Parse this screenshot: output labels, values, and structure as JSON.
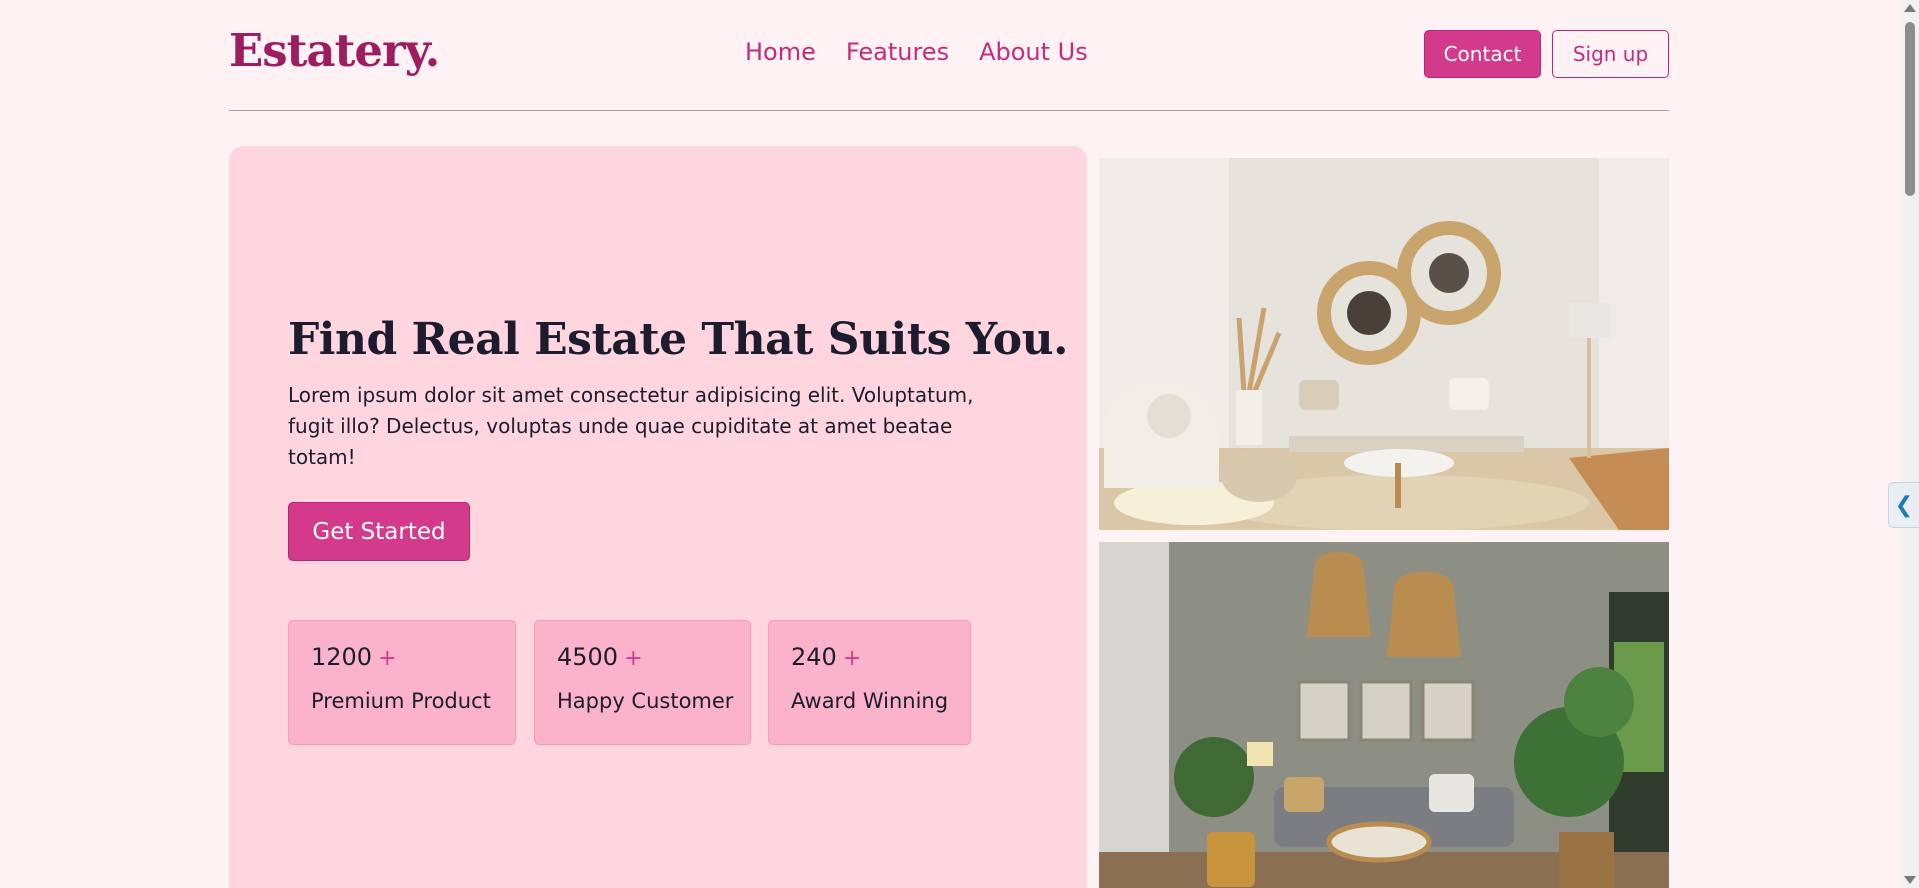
{
  "brand": {
    "logo": "Estatery."
  },
  "nav": {
    "items": [
      "Home",
      "Features",
      "About Us"
    ]
  },
  "header_buttons": {
    "contact": "Contact",
    "signup": "Sign up"
  },
  "hero": {
    "title": "Find Real Estate That Suits You.",
    "description": "Lorem ipsum dolor sit amet consectetur adipisicing elit. Voluptatum, fugit illo? Delectus, voluptas unde quae cupiditate at amet beatae totam!",
    "cta": "Get Started",
    "stats": [
      {
        "number": "1200",
        "plus": "+",
        "label": "Premium Product"
      },
      {
        "number": "4500",
        "plus": "+",
        "label": "Happy Customer"
      },
      {
        "number": "240",
        "plus": "+",
        "label": "Award Winning"
      }
    ]
  },
  "side_tab": {
    "icon": "chevron-left-icon",
    "glyph": "❮"
  },
  "colors": {
    "brand": "#9c1e60",
    "accent": "#d33a8c",
    "hero_bg": "#ffd6e0",
    "page_bg": "#fff2f4",
    "stat_bg": "#fbb2cb"
  }
}
